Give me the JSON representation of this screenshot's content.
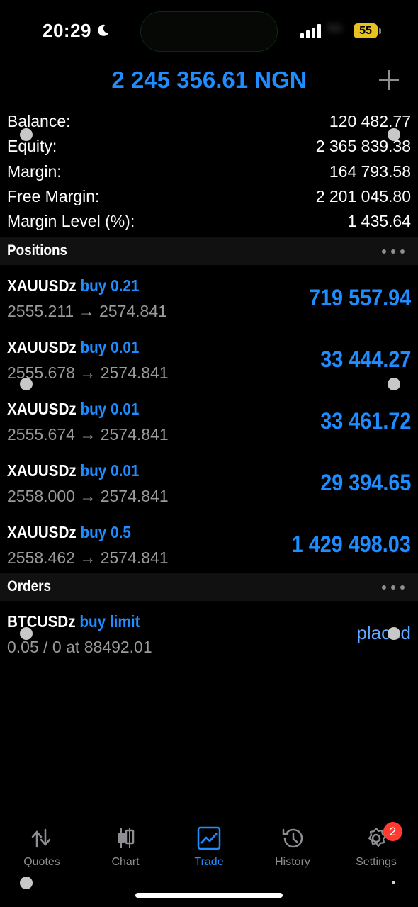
{
  "status_bar": {
    "time": "20:29",
    "carrier": "5G",
    "battery": "55"
  },
  "header": {
    "total": "2 245 356.61 NGN"
  },
  "summary": [
    {
      "label": "Balance:",
      "value": "120 482.77"
    },
    {
      "label": "Equity:",
      "value": "2 365 839.38"
    },
    {
      "label": "Margin:",
      "value": "164 793.58"
    },
    {
      "label": "Free Margin:",
      "value": "2 201 045.80"
    },
    {
      "label": "Margin Level (%):",
      "value": "1 435.64"
    }
  ],
  "positions": {
    "title": "Positions",
    "items": [
      {
        "symbol": "XAUUSDz",
        "side": "buy 0.21",
        "prices": "2555.211 → 2574.841",
        "profit": "719 557.94"
      },
      {
        "symbol": "XAUUSDz",
        "side": "buy 0.01",
        "prices": "2555.678 → 2574.841",
        "profit": "33 444.27"
      },
      {
        "symbol": "XAUUSDz",
        "side": "buy 0.01",
        "prices": "2555.674 → 2574.841",
        "profit": "33 461.72"
      },
      {
        "symbol": "XAUUSDz",
        "side": "buy 0.01",
        "prices": "2558.000 → 2574.841",
        "profit": "29 394.65"
      },
      {
        "symbol": "XAUUSDz",
        "side": "buy 0.5",
        "prices": "2558.462 → 2574.841",
        "profit": "1 429 498.03"
      }
    ]
  },
  "orders": {
    "title": "Orders",
    "items": [
      {
        "symbol": "BTCUSDz",
        "side": "buy limit",
        "detail": "0.05 / 0 at 88492.01",
        "status": "placed"
      }
    ]
  },
  "tabbar": {
    "tabs": [
      {
        "label": "Quotes",
        "icon": "arrows-up-down-icon"
      },
      {
        "label": "Chart",
        "icon": "candlestick-icon"
      },
      {
        "label": "Trade",
        "icon": "trade-chart-icon",
        "active": true
      },
      {
        "label": "History",
        "icon": "history-clock-icon"
      },
      {
        "label": "Settings",
        "icon": "gear-icon",
        "badge": "2"
      }
    ]
  },
  "colors": {
    "accent": "#1f8cff",
    "background": "#000000",
    "section": "#111111",
    "badge": "#ff3b30"
  }
}
